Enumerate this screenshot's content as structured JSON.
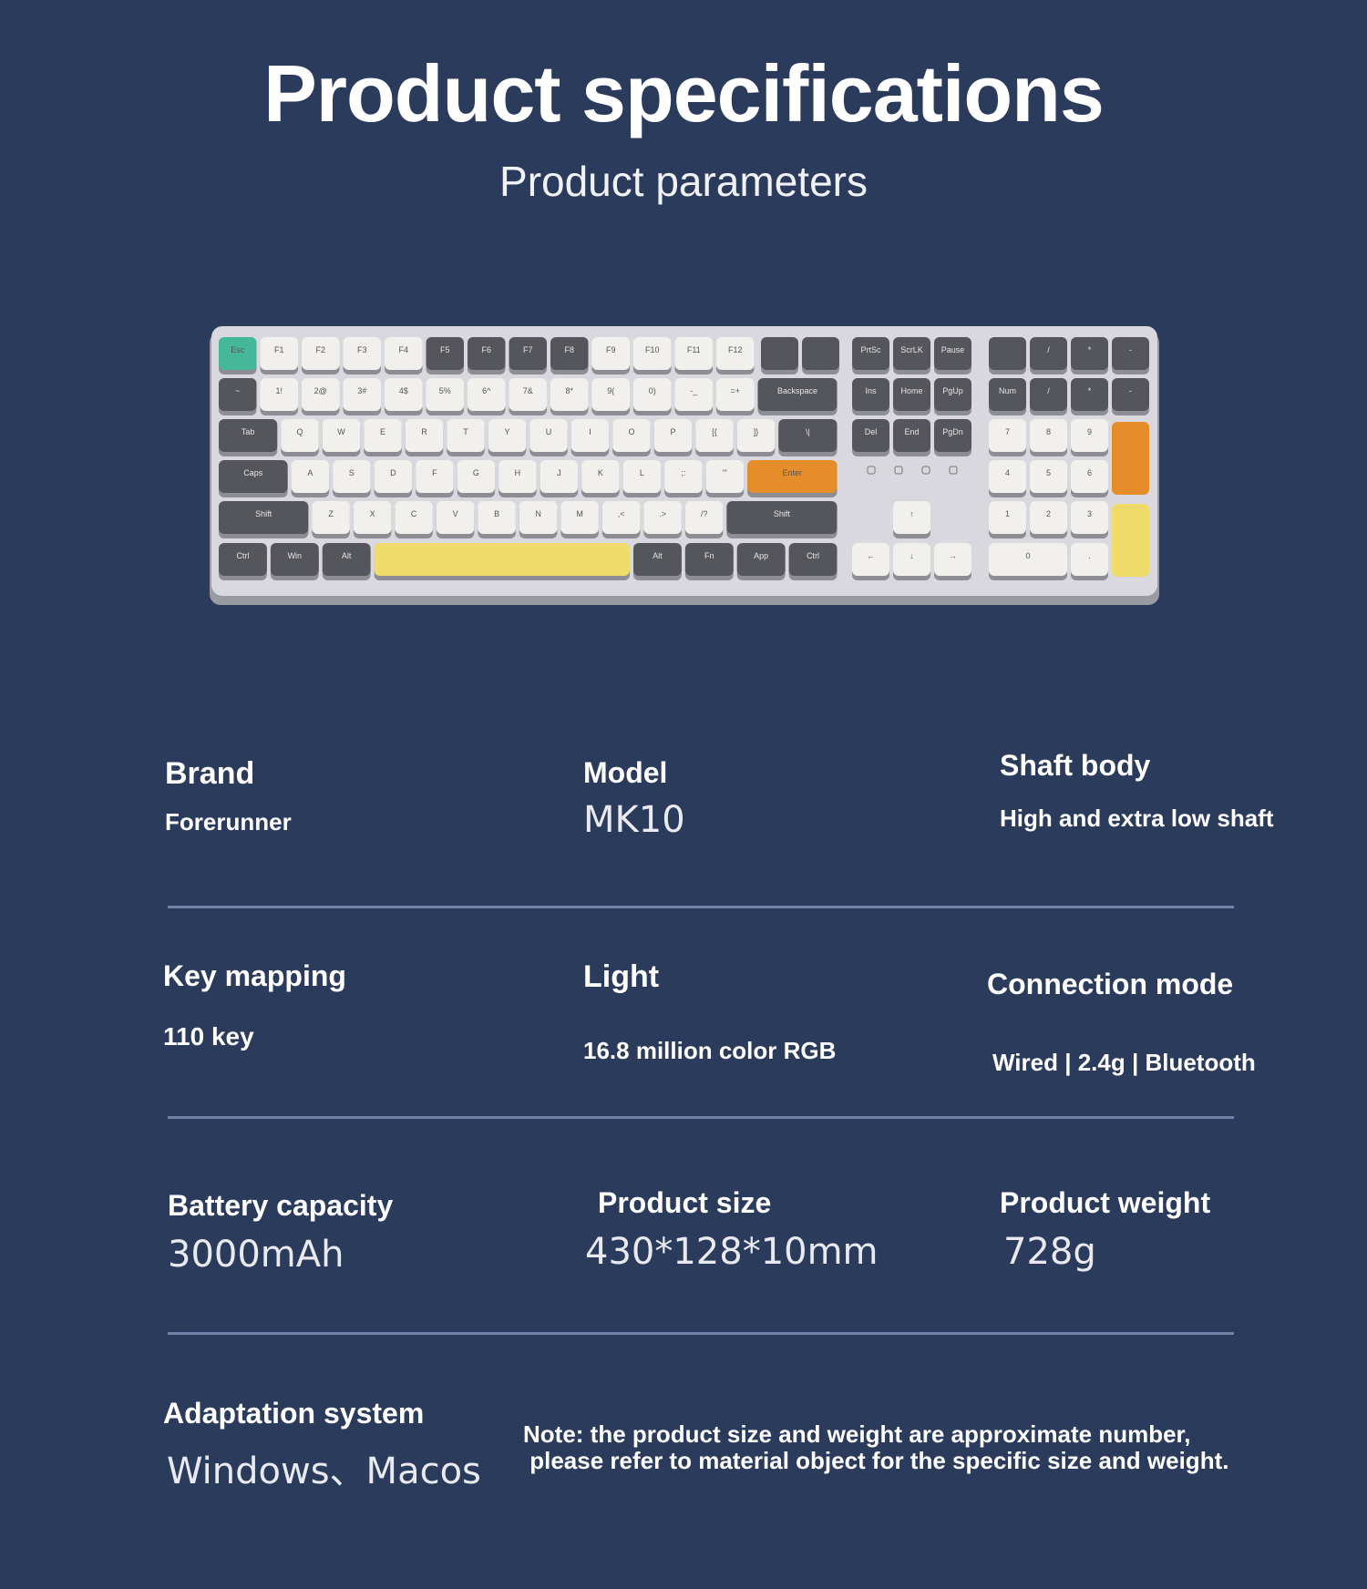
{
  "header": {
    "title": "Product specifications",
    "subtitle": "Product parameters"
  },
  "keyboard": {
    "rows": [
      [
        "Esc",
        "F1",
        "F2",
        "F3",
        "F4",
        "F5",
        "F6",
        "F7",
        "F8",
        "F9",
        "F10",
        "F11",
        "F12"
      ],
      [
        "~",
        "1!",
        "2@",
        "3#",
        "4$",
        "5%",
        "6^",
        "7&",
        "8*",
        "9(",
        "0)",
        "-_",
        "=+",
        "Backspace"
      ],
      [
        "Tab",
        "Q",
        "W",
        "E",
        "R",
        "T",
        "Y",
        "U",
        "I",
        "O",
        "P",
        "[{",
        "]}",
        "\\|"
      ],
      [
        "Caps",
        "A",
        "S",
        "D",
        "F",
        "G",
        "H",
        "J",
        "K",
        "L",
        ";:",
        "'\"",
        "Enter"
      ],
      [
        "Shift",
        "Z",
        "X",
        "C",
        "V",
        "B",
        "N",
        "M",
        ",<",
        ".>",
        "/?",
        "Shift"
      ],
      [
        "Ctrl",
        "Win",
        "Alt",
        "Alt",
        "Fn",
        "App",
        "Ctrl"
      ]
    ],
    "nav_keys": [
      "PrtSc",
      "ScrLK",
      "Pause",
      "Ins",
      "Home",
      "PgUp",
      "Del",
      "End",
      "PgDn"
    ],
    "numpad_top": [
      "",
      "/",
      "*",
      "-"
    ],
    "colors": {
      "body": "#d8d8de",
      "light_key": "#f1f0ec",
      "dark_key": "#55565c",
      "accent_green": "#45b89a",
      "accent_orange": "#e48d2a",
      "accent_yellow": "#efdb6a"
    }
  },
  "specs": {
    "brand": {
      "label": "Brand",
      "value": "Forerunner"
    },
    "model": {
      "label": "Model",
      "value": "MK10"
    },
    "shaft": {
      "label": "Shaft body",
      "value": "High and extra low shaft"
    },
    "key_mapping": {
      "label": "Key mapping",
      "value": "110 key"
    },
    "light": {
      "label": "Light",
      "value": "16.8 million color RGB"
    },
    "connection": {
      "label": "Connection mode",
      "value": "Wired | 2.4g | Bluetooth"
    },
    "battery": {
      "label": "Battery capacity",
      "value": "3000mAh"
    },
    "size": {
      "label": "Product size",
      "value": "430*128*10mm"
    },
    "weight": {
      "label": "Product weight",
      "value": "728g"
    },
    "system": {
      "label": "Adaptation system",
      "value": "Windows、Macos"
    }
  },
  "note": {
    "line1": "Note: the product size and weight are approximate number,",
    "line2": " please refer to material object for the specific size and weight."
  }
}
